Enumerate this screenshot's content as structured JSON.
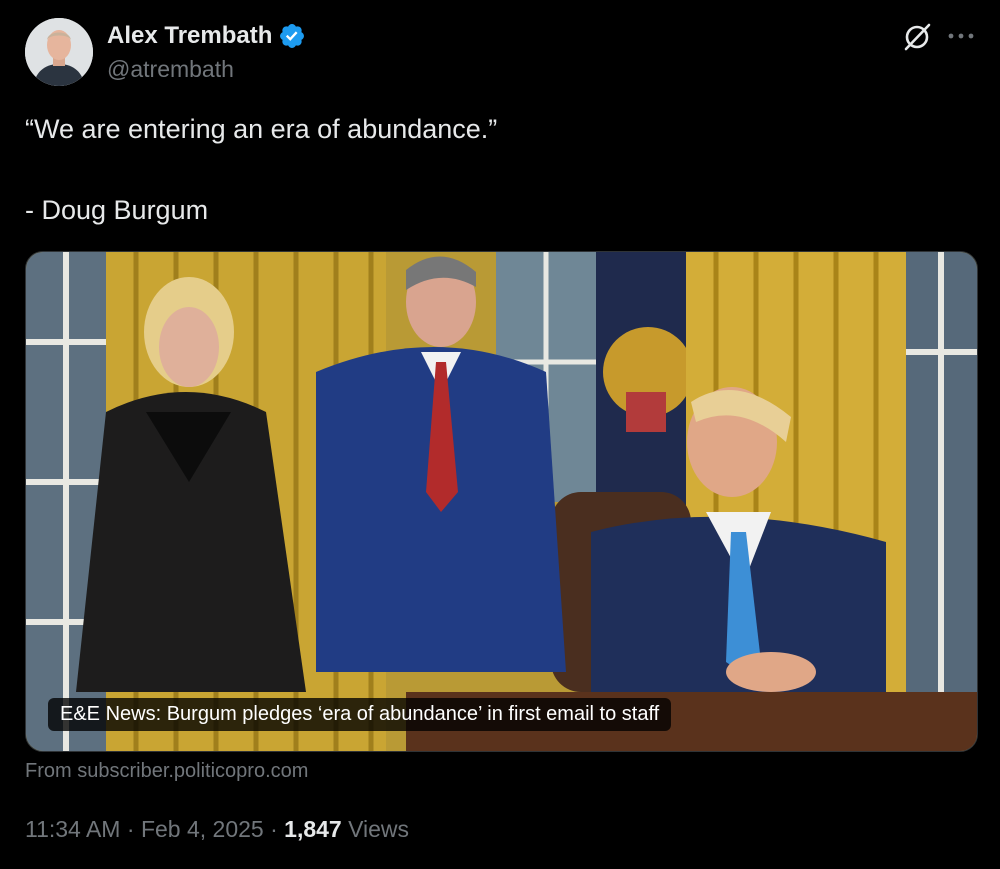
{
  "author": {
    "name": "Alex Trembath",
    "handle": "@atrembath",
    "verified_color": "#1d9bf0"
  },
  "icons": [
    "grok-icon",
    "more-icon",
    "verified-badge-icon"
  ],
  "tweet": {
    "quote": "“We are entering an era of abundance.”",
    "attribution": "- Doug Burgum"
  },
  "card": {
    "caption": "E&E News: Burgum pledges ‘era of abundance’ in first email to staff",
    "source": "From subscriber.politicopro.com"
  },
  "meta": {
    "time": "11:34 AM",
    "separator": "·",
    "date": "Feb 4, 2025",
    "views_count": "1,847",
    "views_label": "Views"
  }
}
